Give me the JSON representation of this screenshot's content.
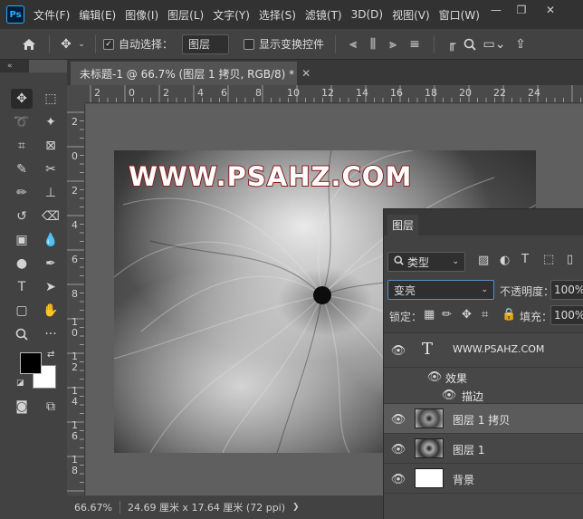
{
  "app": {
    "logo_text": "Ps",
    "menu": [
      "文件(F)",
      "编辑(E)",
      "图像(I)",
      "图层(L)",
      "文字(Y)",
      "选择(S)",
      "滤镜(T)",
      "3D(D)",
      "视图(V)",
      "窗口(W)"
    ]
  },
  "options_bar": {
    "auto_select_label": "自动选择：",
    "auto_select_target": "图层",
    "show_transform_label": "显示变换控件"
  },
  "document": {
    "tab_title": "未标题-1 @ 66.7% (图层 1 拷贝, RGB/8) *",
    "canvas_text": "WWW.PSAHZ.COM",
    "ruler_top_ticks": [
      "2",
      "0",
      "2",
      "4",
      "6",
      "8",
      "10",
      "12",
      "14",
      "16",
      "18",
      "20",
      "22",
      "24"
    ],
    "ruler_left_ticks": [
      "2",
      "0",
      "2",
      "4",
      "6",
      "8",
      "1\n0",
      "1\n2",
      "1\n4",
      "1\n6",
      "1\n8"
    ]
  },
  "status": {
    "zoom": "66.67%",
    "doc_size": "24.69 厘米 x 17.64 厘米 (72 ppi)",
    "arrow": "❯"
  },
  "layers_panel": {
    "tab_label": "图层",
    "filter_label": "类型",
    "blend_mode": "变亮",
    "opacity_label": "不透明度：",
    "opacity_value": "100%",
    "lock_label": "锁定：",
    "fill_label": "填充：",
    "fill_value": "100%",
    "layers": [
      {
        "name": "WWW.PSAHZ.COM",
        "type": "text"
      },
      {
        "name": "效果",
        "type": "effects"
      },
      {
        "name": "描边",
        "type": "effect"
      },
      {
        "name": "图层 1 拷贝",
        "type": "image",
        "selected": true
      },
      {
        "name": "图层 1",
        "type": "image"
      },
      {
        "name": "背景",
        "type": "background"
      }
    ]
  },
  "colors": {
    "accent": "#31a8ff",
    "canvas_text_stroke": "#8a1a1a",
    "foreground_swatch": "#000000",
    "background_swatch": "#ffffff"
  }
}
